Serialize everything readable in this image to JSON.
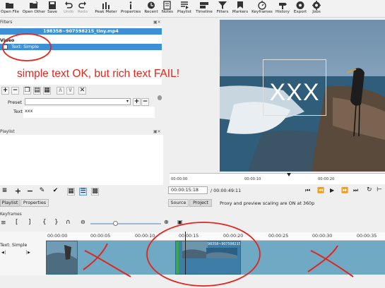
{
  "toolbar": {
    "items": [
      {
        "label": "Open File",
        "icon": "folder-open-icon"
      },
      {
        "label": "Open Other",
        "icon": "folder-other-icon"
      },
      {
        "label": "Save",
        "icon": "save-icon"
      },
      {
        "label": "Undo",
        "icon": "undo-icon",
        "disabled": true
      },
      {
        "label": "Redo",
        "icon": "redo-icon",
        "disabled": true
      },
      {
        "label": "Peak Meter",
        "icon": "peak-meter-icon"
      },
      {
        "label": "Properties",
        "icon": "info-icon"
      },
      {
        "label": "Recent",
        "icon": "clock-icon"
      },
      {
        "label": "Notes",
        "icon": "notes-icon"
      },
      {
        "label": "Playlist",
        "icon": "playlist-icon"
      },
      {
        "label": "Timeline",
        "icon": "timeline-icon"
      },
      {
        "label": "Filters",
        "icon": "filter-icon"
      },
      {
        "label": "Markers",
        "icon": "marker-icon"
      },
      {
        "label": "Keyframes",
        "icon": "keyframes-icon"
      },
      {
        "label": "History",
        "icon": "history-icon"
      },
      {
        "label": "Export",
        "icon": "export-icon"
      },
      {
        "label": "Jobs",
        "icon": "jobs-icon"
      }
    ]
  },
  "filters": {
    "title": "Filters",
    "file_name": "198358~907598215_tiny.mp4",
    "category": "Video",
    "item": "Text: Simple",
    "preset_label": "Preset",
    "text_label": "Text",
    "text_value": "xxx"
  },
  "annotation": {
    "text": "simple text OK, but rich text FAIL!",
    "color": "#e0261e"
  },
  "playlist": {
    "title": "Playlist",
    "tabs": [
      "Playlist",
      "Properties"
    ]
  },
  "player": {
    "overlay_text": "XXX",
    "current_time": "00:00:15:18",
    "total_time": "/ 00:00:49:11",
    "ruler_labels": [
      "00:00:00",
      "00:00:10",
      "00:00:20"
    ],
    "tabs": [
      "Source",
      "Project"
    ],
    "active_tab": "Project",
    "status_text": "Proxy and preview scaling are ON at 360p"
  },
  "keyframes": {
    "title": "Keyframes",
    "track_name": "Text: Simple",
    "ruler_labels": [
      "00:00:00",
      "00:00:05",
      "00:00:10",
      "00:00:15",
      "00:00:20",
      "00:00:25",
      "00:00:30",
      "00:00:35"
    ],
    "clip_label": "198358~907598215"
  },
  "colors": {
    "selection": "#3d8fd6",
    "annotation": "#e0261e",
    "track": "#6fa9c4"
  }
}
